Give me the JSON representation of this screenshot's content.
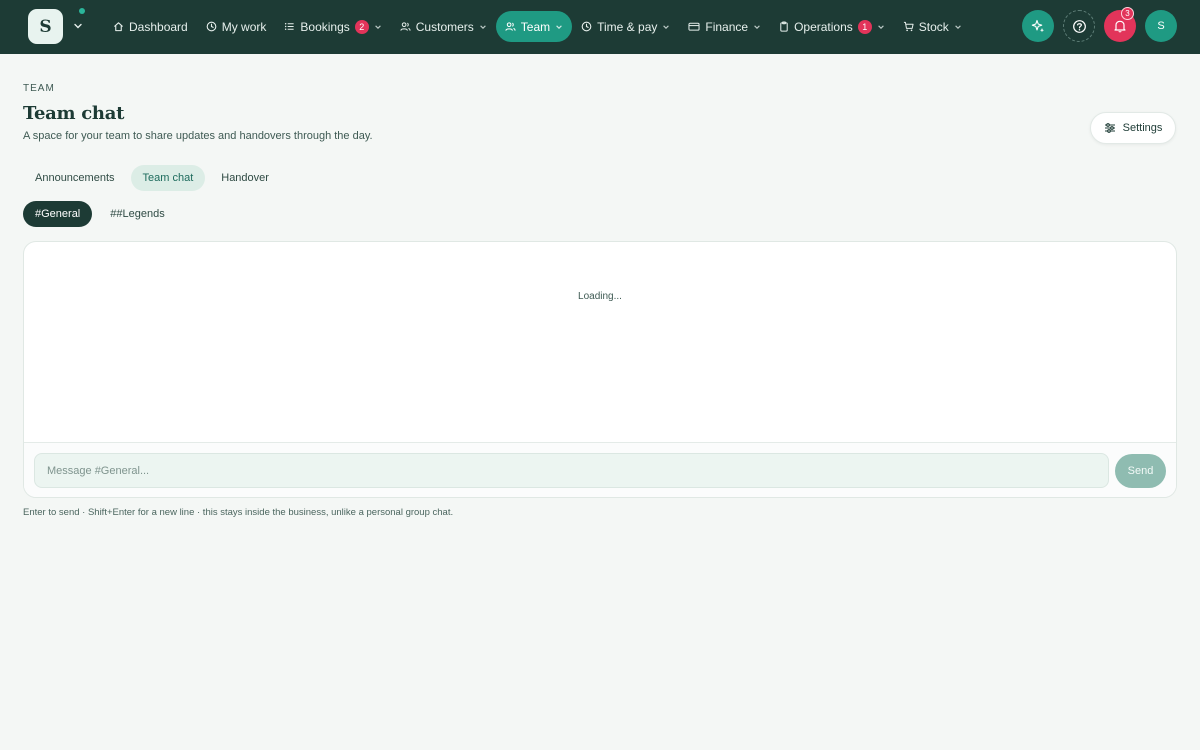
{
  "brand": {
    "letter": "S"
  },
  "nav": {
    "items": [
      {
        "label": "Dashboard",
        "icon": "home-icon"
      },
      {
        "label": "My work",
        "icon": "clock-icon"
      },
      {
        "label": "Bookings",
        "icon": "list-icon",
        "badge": "2",
        "has_menu": true
      },
      {
        "label": "Customers",
        "icon": "users-icon",
        "has_menu": true
      },
      {
        "label": "Team",
        "icon": "team-icon",
        "has_menu": true,
        "active": true
      },
      {
        "label": "Time & pay",
        "icon": "clock-icon",
        "has_menu": true
      },
      {
        "label": "Finance",
        "icon": "card-icon",
        "has_menu": true
      },
      {
        "label": "Operations",
        "icon": "clipboard-icon",
        "badge": "1",
        "has_menu": true
      },
      {
        "label": "Stock",
        "icon": "cart-icon",
        "has_menu": true
      }
    ]
  },
  "actions": {
    "notifications_count": "3",
    "avatar_letter": "S"
  },
  "header": {
    "eyebrow": "TEAM",
    "title": "Team chat",
    "subtitle": "A space for your team to share updates and handovers through the day.",
    "settings_label": "Settings"
  },
  "tabs": [
    {
      "label": "Announcements"
    },
    {
      "label": "Team chat",
      "active": true
    },
    {
      "label": "Handover"
    }
  ],
  "channels": [
    {
      "label": "#General",
      "active": true
    },
    {
      "label": "##Legends"
    }
  ],
  "chat": {
    "loading_text": "Loading...",
    "input_placeholder": "Message #General...",
    "input_value": "",
    "send_label": "Send",
    "hint": "Enter to send · Shift+Enter for a new line · this stays inside the business, unlike a personal group chat."
  },
  "colors": {
    "topbar": "#1d3b35",
    "accent": "#1f9a83",
    "badge": "#e2345a",
    "page_bg": "#f4f7f5"
  }
}
